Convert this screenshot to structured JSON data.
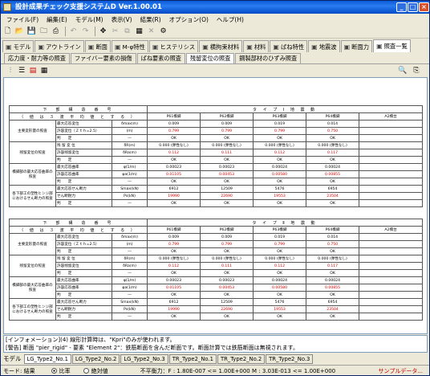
{
  "window": {
    "title": "設計成果チェック支援システムD  Ver.1.00.01"
  },
  "menu": [
    "ファイル(F)",
    "編集(E)",
    "モデル(M)",
    "表示(V)",
    "結果(R)",
    "オプション(O)",
    "ヘルプ(H)"
  ],
  "toolbar_icons": [
    "new-icon",
    "open-icon",
    "save-icon",
    "folder-icon",
    "print-icon",
    "undo-icon",
    "redo-icon",
    "move-icon",
    "cut-icon",
    "copy-icon",
    "grid-icon",
    "delete-icon",
    "settings-icon"
  ],
  "main_tabs": [
    {
      "label": "モデル",
      "icon": "model-icon"
    },
    {
      "label": "アウトライン",
      "icon": "outline-icon"
    },
    {
      "label": "断面",
      "icon": "section-icon"
    },
    {
      "label": "M-φ特性",
      "icon": "mphi-icon"
    },
    {
      "label": "ヒステリシス",
      "icon": "hysteresis-icon"
    },
    {
      "label": "横拘束材料",
      "icon": "confine-icon"
    },
    {
      "label": "材料",
      "icon": "material-icon"
    },
    {
      "label": "ばね特性",
      "icon": "spring-icon"
    },
    {
      "label": "地震波",
      "icon": "wave-icon"
    },
    {
      "label": "断面力",
      "icon": "force-icon"
    },
    {
      "label": "照査一覧",
      "icon": "check-icon"
    }
  ],
  "sub_tabs": [
    "応力度・耐力等の照査",
    "ファイバー要素の損傷",
    "ばね要素の照査",
    "残留変位の照査",
    "鋼製部材のひずみ照査"
  ],
  "active_sub_tab": 3,
  "report": {
    "header_left_1": "下　部　構　造　番　号",
    "header_left_2": "（ 値 は ３ 波 平 均 値 と す る ）",
    "piers": [
      "P61橋脚",
      "P62橋脚",
      "P63橋脚",
      "P64橋脚",
      "A2橋台"
    ],
    "tables": [
      {
        "type_label": "タ イ プ Ⅰ 地 震 動",
        "rows": [
          {
            "group": "主要変形量の照査",
            "item": "最大応答変位",
            "unit": "δmax(m)",
            "vals": [
              "0.009",
              "0.009",
              "0.019",
              "0.014",
              ""
            ],
            "red": false
          },
          {
            "group": "",
            "item": "許容変位（Ｚｔｈ=2.5）",
            "unit": "(m)",
            "vals": [
              "0.799",
              "0.799",
              "0.799",
              "0.750",
              ""
            ],
            "red": true
          },
          {
            "group": "",
            "item": "判　　定",
            "unit": "―",
            "vals": [
              "OK",
              "OK",
              "OK",
              "OK",
              ""
            ],
            "red": false
          },
          {
            "group": "残留変位の照査",
            "item": "残 留 変 位",
            "unit": "δR(m)",
            "vals": [
              "0.000 (弾性なし)",
              "0.000 (弾性なし)",
              "0.000 (弾性なし)",
              "0.000 (弾性なし)",
              ""
            ],
            "red": false
          },
          {
            "group": "",
            "item": "許容残留変位",
            "unit": "δRa(m)",
            "vals": [
              "0.112",
              "0.111",
              "0.112",
              "0.117",
              ""
            ],
            "red": true
          },
          {
            "group": "",
            "item": "判　　定",
            "unit": "―",
            "vals": [
              "OK",
              "OK",
              "OK",
              "OK",
              ""
            ],
            "red": false
          },
          {
            "group": "橋脚部の最大応答曲率の照査",
            "item": "最大応答曲率",
            "unit": "φ(1/m)",
            "vals": [
              "0.00023",
              "0.00023",
              "0.00024",
              "0.00024",
              ""
            ],
            "red": false
          },
          {
            "group": "",
            "item": "許容応答曲率",
            "unit": "φa(1/m)",
            "vals": [
              "0.01105",
              "0.00453",
              "0.00580",
              "0.00855",
              ""
            ],
            "red": true
          },
          {
            "group": "",
            "item": "判　　定",
            "unit": "―",
            "vals": [
              "OK",
              "OK",
              "OK",
              "OK",
              ""
            ],
            "red": false
          },
          {
            "group": "各下部工の塑性ヒンジ部におけるせん断力の照査",
            "item": "最大応答せん断力",
            "unit": "Smax(kN)",
            "vals": [
              "6912",
              "12509",
              "5476",
              "6954",
              ""
            ],
            "red": false
          },
          {
            "group": "",
            "item": "せん断耐力",
            "unit": "Ps(kN)",
            "vals": [
              "19990",
              "22690",
              "19553",
              "23504",
              ""
            ],
            "red": true
          },
          {
            "group": "",
            "item": "判　　定",
            "unit": "―",
            "vals": [
              "OK",
              "OK",
              "OK",
              "OK",
              ""
            ],
            "red": false
          }
        ]
      },
      {
        "type_label": "タ イ プ Ⅱ 地 震 動",
        "rows": [
          {
            "group": "主要変形量の照査",
            "item": "最大応答変位",
            "unit": "δmax(m)",
            "vals": [
              "0.009",
              "0.009",
              "0.019",
              "0.014",
              ""
            ],
            "red": false
          },
          {
            "group": "",
            "item": "許容変位（Ｚｔｈ=2.5）",
            "unit": "(m)",
            "vals": [
              "0.799",
              "0.799",
              "0.799",
              "0.750",
              ""
            ],
            "red": true
          },
          {
            "group": "",
            "item": "判　　定",
            "unit": "―",
            "vals": [
              "OK",
              "OK",
              "OK",
              "OK",
              ""
            ],
            "red": false
          },
          {
            "group": "残留変位の照査",
            "item": "残 留 変 位",
            "unit": "δR(m)",
            "vals": [
              "0.000 (弾性なし)",
              "0.000 (弾性なし)",
              "0.000 (弾性なし)",
              "0.000 (弾性なし)",
              ""
            ],
            "red": false
          },
          {
            "group": "",
            "item": "許容残留変位",
            "unit": "δRa(m)",
            "vals": [
              "0.112",
              "0.111",
              "0.112",
              "0.117",
              ""
            ],
            "red": true
          },
          {
            "group": "",
            "item": "判　　定",
            "unit": "―",
            "vals": [
              "OK",
              "OK",
              "OK",
              "OK",
              ""
            ],
            "red": false
          },
          {
            "group": "橋脚部の最大応答曲率の照査",
            "item": "最大応答曲率",
            "unit": "φ(1/m)",
            "vals": [
              "0.00023",
              "0.00023",
              "0.00024",
              "0.00024",
              ""
            ],
            "red": false
          },
          {
            "group": "",
            "item": "許容応答曲率",
            "unit": "φa(1/m)",
            "vals": [
              "0.01105",
              "0.00453",
              "0.00580",
              "0.00855",
              ""
            ],
            "red": true
          },
          {
            "group": "",
            "item": "判　　定",
            "unit": "―",
            "vals": [
              "OK",
              "OK",
              "OK",
              "OK",
              ""
            ],
            "red": false
          },
          {
            "group": "各下部工の塑性ヒンジ部におけるせん断力の照査",
            "item": "最大応答せん断力",
            "unit": "Smax(kN)",
            "vals": [
              "6912",
              "12509",
              "5476",
              "6954",
              ""
            ],
            "red": false
          },
          {
            "group": "",
            "item": "せん断耐力",
            "unit": "Ps(kN)",
            "vals": [
              "19990",
              "22690",
              "19553",
              "23504",
              ""
            ],
            "red": true
          },
          {
            "group": "",
            "item": "判　　定",
            "unit": "―",
            "vals": [
              "OK",
              "OK",
              "OK",
              "OK",
              ""
            ],
            "red": false
          }
        ]
      }
    ]
  },
  "info": {
    "line1": "[インフォメーション](4) 線形計算時は、\"Kpri\"のみが使われます。",
    "line2": "[警告] 断面 \"pier_rigid\" - 要素 \"Element 2\"：鉄筋断面を含んだ断面です。断面計算では鉄筋断面は無視されます。"
  },
  "bottom_tabs": {
    "label": "モデル",
    "items": [
      "LG_Type2_No.1",
      "LG_Type2_No.2",
      "LG_Type2_No.3",
      "TR_Type2_No.1",
      "TR_Type2_No.2",
      "TR_Type2_No.3"
    ],
    "active": 0
  },
  "status": {
    "mode": "モード: 結果",
    "radio1": "比率",
    "radio2": "絶対値",
    "radio_selected": 0,
    "balance": "不平衡力：F : 1.80E-007 <= 1.00E+000  M : 3.03E-013 <= 1.00E+000",
    "warn": "サンプルデータ..."
  }
}
